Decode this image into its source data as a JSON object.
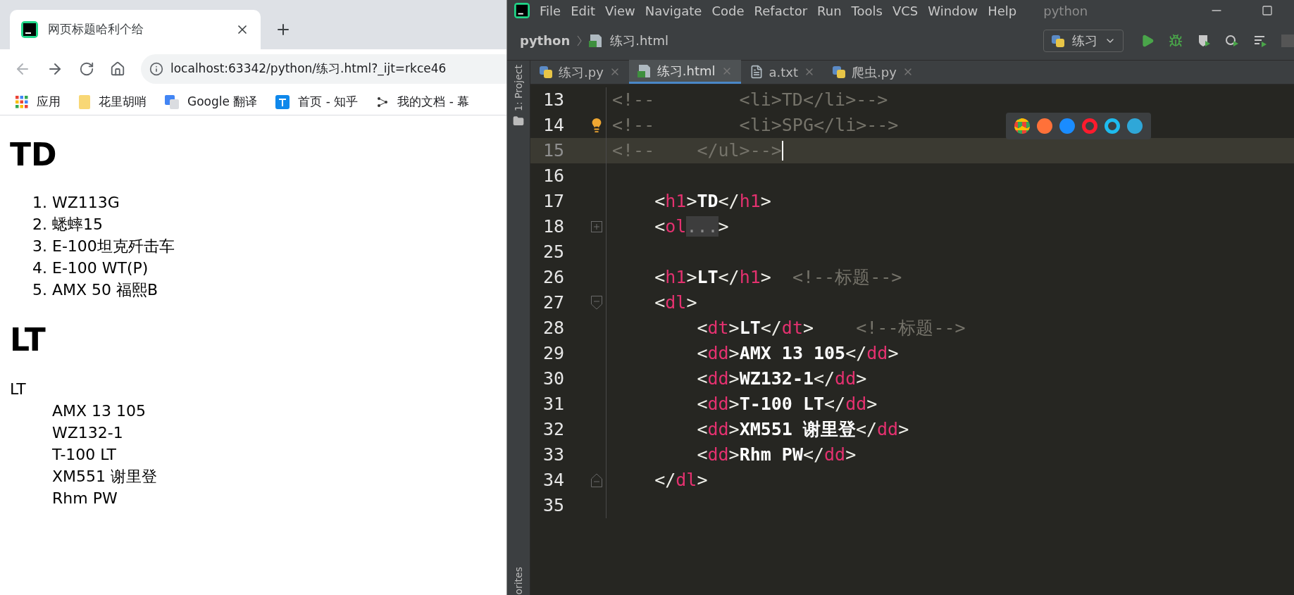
{
  "browser": {
    "tab": {
      "title": "网页标题哈利个给"
    },
    "address": "localhost:63342/python/练习.html?_ijt=rkce46",
    "bookmarks": [
      {
        "kind": "apps",
        "label": "应用"
      },
      {
        "kind": "folder",
        "label": "花里胡哨"
      },
      {
        "kind": "translate",
        "label": "Google 翻译"
      },
      {
        "kind": "zhihu",
        "label": "首页 - 知乎"
      },
      {
        "kind": "mubu",
        "label": "我的文档 - 幕"
      }
    ],
    "page": {
      "heading_1": "TD",
      "ordered_list": [
        {
          "number": "1.",
          "text": "WZ113G"
        },
        {
          "number": "2.",
          "text": "蟋蟀15"
        },
        {
          "number": "3.",
          "text": "E-100坦克歼击车"
        },
        {
          "number": "4.",
          "text": "E-100 WT(P)"
        },
        {
          "number": "5.",
          "text": "AMX 50 福熙B"
        }
      ],
      "heading_2": "LT",
      "term": "LT",
      "definitions": [
        "AMX 13 105",
        "WZ132-1",
        "T-100 LT",
        "XM551 谢里登",
        "Rhm PW"
      ]
    }
  },
  "ide": {
    "menu": [
      "File",
      "Edit",
      "View",
      "Navigate",
      "Code",
      "Refactor",
      "Run",
      "Tools",
      "VCS",
      "Window",
      "Help"
    ],
    "project_title": "python",
    "breadcrumb": [
      "python",
      "练习.html"
    ],
    "run_config": "练习",
    "side_labels": [
      "1: Project",
      "orites"
    ],
    "tabs": [
      {
        "label": "练习.py",
        "kind": "py",
        "selected": false
      },
      {
        "label": "练习.html",
        "kind": "html",
        "selected": true
      },
      {
        "label": "a.txt",
        "kind": "txt",
        "selected": false
      },
      {
        "label": "爬虫.py",
        "kind": "py",
        "selected": false
      }
    ],
    "lines": [
      {
        "number": "13",
        "kind": "plain",
        "tokens": [
          {
            "kind": "comment",
            "text": "<!--        <li>TD</li>-->"
          }
        ]
      },
      {
        "number": "14",
        "kind": "plain",
        "bulb": true,
        "tokens": [
          {
            "kind": "comment",
            "text": "<!--        <li>SPG</li>-->"
          }
        ]
      },
      {
        "number": "15",
        "kind": "plain",
        "current": true,
        "tokens": [
          {
            "kind": "comment",
            "text": "<!--    </ul>-->"
          }
        ]
      },
      {
        "number": "16",
        "kind": "plain"
      },
      {
        "number": "17",
        "kind": "plain",
        "tokens": [
          {
            "kind": "punct",
            "text": "    <"
          },
          {
            "kind": "tag",
            "text": "h1"
          },
          {
            "kind": "punct",
            "text": ">"
          },
          {
            "kind": "text",
            "text": "TD"
          },
          {
            "kind": "punct",
            "text": "</"
          },
          {
            "kind": "tag",
            "text": "h1"
          },
          {
            "kind": "punct",
            "text": ">"
          }
        ]
      },
      {
        "number": "18",
        "kind": "folded",
        "tokens": [
          {
            "kind": "punct",
            "text": "    <"
          },
          {
            "kind": "tag",
            "text": "ol"
          },
          {
            "kind": "folded",
            "text": "..."
          },
          {
            "kind": "punct",
            "text": ">"
          }
        ]
      },
      {
        "number": "25",
        "kind": "plain"
      },
      {
        "number": "26",
        "kind": "plain",
        "tokens": [
          {
            "kind": "punct",
            "text": "    <"
          },
          {
            "kind": "tag",
            "text": "h1"
          },
          {
            "kind": "punct",
            "text": ">"
          },
          {
            "kind": "text",
            "text": "LT"
          },
          {
            "kind": "punct",
            "text": "</"
          },
          {
            "kind": "tag",
            "text": "h1"
          },
          {
            "kind": "punct",
            "text": ">"
          },
          {
            "kind": "comment",
            "text": "  <!--标题-->"
          }
        ]
      },
      {
        "number": "27",
        "kind": "foldstart",
        "tokens": [
          {
            "kind": "punct",
            "text": "    <"
          },
          {
            "kind": "tag",
            "text": "dl"
          },
          {
            "kind": "punct",
            "text": ">"
          }
        ]
      },
      {
        "number": "28",
        "kind": "plain",
        "tokens": [
          {
            "kind": "punct",
            "text": "        <"
          },
          {
            "kind": "tag",
            "text": "dt"
          },
          {
            "kind": "punct",
            "text": ">"
          },
          {
            "kind": "text",
            "text": "LT"
          },
          {
            "kind": "punct",
            "text": "</"
          },
          {
            "kind": "tag",
            "text": "dt"
          },
          {
            "kind": "punct",
            "text": ">"
          },
          {
            "kind": "comment",
            "text": "    <!--标题-->"
          }
        ]
      },
      {
        "number": "29",
        "kind": "plain",
        "tokens": [
          {
            "kind": "punct",
            "text": "        <"
          },
          {
            "kind": "tag",
            "text": "dd"
          },
          {
            "kind": "punct",
            "text": ">"
          },
          {
            "kind": "text",
            "text": "AMX 13 105"
          },
          {
            "kind": "punct",
            "text": "</"
          },
          {
            "kind": "tag",
            "text": "dd"
          },
          {
            "kind": "punct",
            "text": ">"
          }
        ]
      },
      {
        "number": "30",
        "kind": "plain",
        "tokens": [
          {
            "kind": "punct",
            "text": "        <"
          },
          {
            "kind": "tag",
            "text": "dd"
          },
          {
            "kind": "punct",
            "text": ">"
          },
          {
            "kind": "text",
            "text": "WZ132-1"
          },
          {
            "kind": "punct",
            "text": "</"
          },
          {
            "kind": "tag",
            "text": "dd"
          },
          {
            "kind": "punct",
            "text": ">"
          }
        ]
      },
      {
        "number": "31",
        "kind": "plain",
        "tokens": [
          {
            "kind": "punct",
            "text": "        <"
          },
          {
            "kind": "tag",
            "text": "dd"
          },
          {
            "kind": "punct",
            "text": ">"
          },
          {
            "kind": "text",
            "text": "T-100 LT"
          },
          {
            "kind": "punct",
            "text": "</"
          },
          {
            "kind": "tag",
            "text": "dd"
          },
          {
            "kind": "punct",
            "text": ">"
          }
        ]
      },
      {
        "number": "32",
        "kind": "plain",
        "tokens": [
          {
            "kind": "punct",
            "text": "        <"
          },
          {
            "kind": "tag",
            "text": "dd"
          },
          {
            "kind": "punct",
            "text": ">"
          },
          {
            "kind": "text",
            "text": "XM551 谢里登"
          },
          {
            "kind": "punct",
            "text": "</"
          },
          {
            "kind": "tag",
            "text": "dd"
          },
          {
            "kind": "punct",
            "text": ">"
          }
        ]
      },
      {
        "number": "33",
        "kind": "plain",
        "tokens": [
          {
            "kind": "punct",
            "text": "        <"
          },
          {
            "kind": "tag",
            "text": "dd"
          },
          {
            "kind": "punct",
            "text": ">"
          },
          {
            "kind": "text",
            "text": "Rhm PW"
          },
          {
            "kind": "punct",
            "text": "</"
          },
          {
            "kind": "tag",
            "text": "dd"
          },
          {
            "kind": "punct",
            "text": ">"
          }
        ]
      },
      {
        "number": "34",
        "kind": "foldend",
        "tokens": [
          {
            "kind": "punct",
            "text": "    </"
          },
          {
            "kind": "tag",
            "text": "dl"
          },
          {
            "kind": "punct",
            "text": ">"
          }
        ]
      },
      {
        "number": "35",
        "kind": "plain"
      }
    ]
  }
}
